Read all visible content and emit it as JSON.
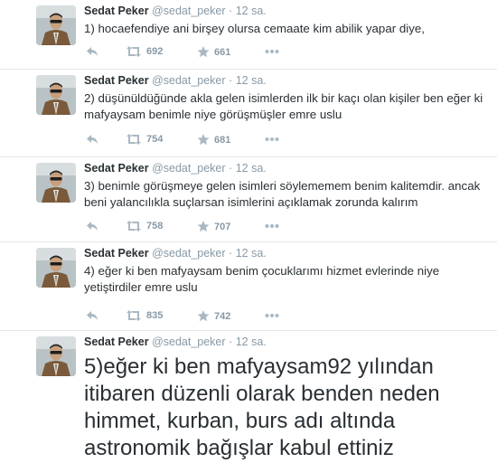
{
  "tweets": [
    {
      "name": "Sedat Peker",
      "handle": "@sedat_peker",
      "dot": "·",
      "time": "12 sa.",
      "text": "1) hocaefendiye ani birşey olursa cemaate kim abilik yapar diye,",
      "retweets": "692",
      "favorites": "661"
    },
    {
      "name": "Sedat Peker",
      "handle": "@sedat_peker",
      "dot": "·",
      "time": "12 sa.",
      "text": "2) düşünüldüğünde akla gelen isimlerden ilk bir kaçı olan kişiler ben eğer ki mafyaysam benimle niye görüşmüşler emre uslu",
      "retweets": "754",
      "favorites": "681"
    },
    {
      "name": "Sedat Peker",
      "handle": "@sedat_peker",
      "dot": "·",
      "time": "12 sa.",
      "text": "3) benimle görüşmeye gelen isimleri söylememem benim kalitemdir. ancak beni yalancılıkla suçlarsan isimlerini açıklamak zorunda kalırım",
      "retweets": "758",
      "favorites": "707"
    },
    {
      "name": "Sedat Peker",
      "handle": "@sedat_peker",
      "dot": "·",
      "time": "12 sa.",
      "text": "4) eğer ki ben mafyaysam benim çocuklarımı hizmet evlerinde niye yetiştirdiler emre uslu",
      "retweets": "835",
      "favorites": "742"
    },
    {
      "name": "Sedat Peker",
      "handle": "@sedat_peker",
      "dot": "·",
      "time": "12 sa.",
      "text": "5)eğer ki ben mafyaysam92 yılından itibaren düzenli olarak benden neden himmet, kurban, burs adı altında astronomik bağışlar kabul ettiniz"
    }
  ],
  "icons": {
    "reply": "reply-icon",
    "retweet": "retweet-icon",
    "favorite": "star-icon",
    "more": "more-icon"
  },
  "colors": {
    "name": "#292f33",
    "meta": "#8899a6",
    "action_icon": "#aab8c2",
    "divider": "#e1e8ed"
  }
}
